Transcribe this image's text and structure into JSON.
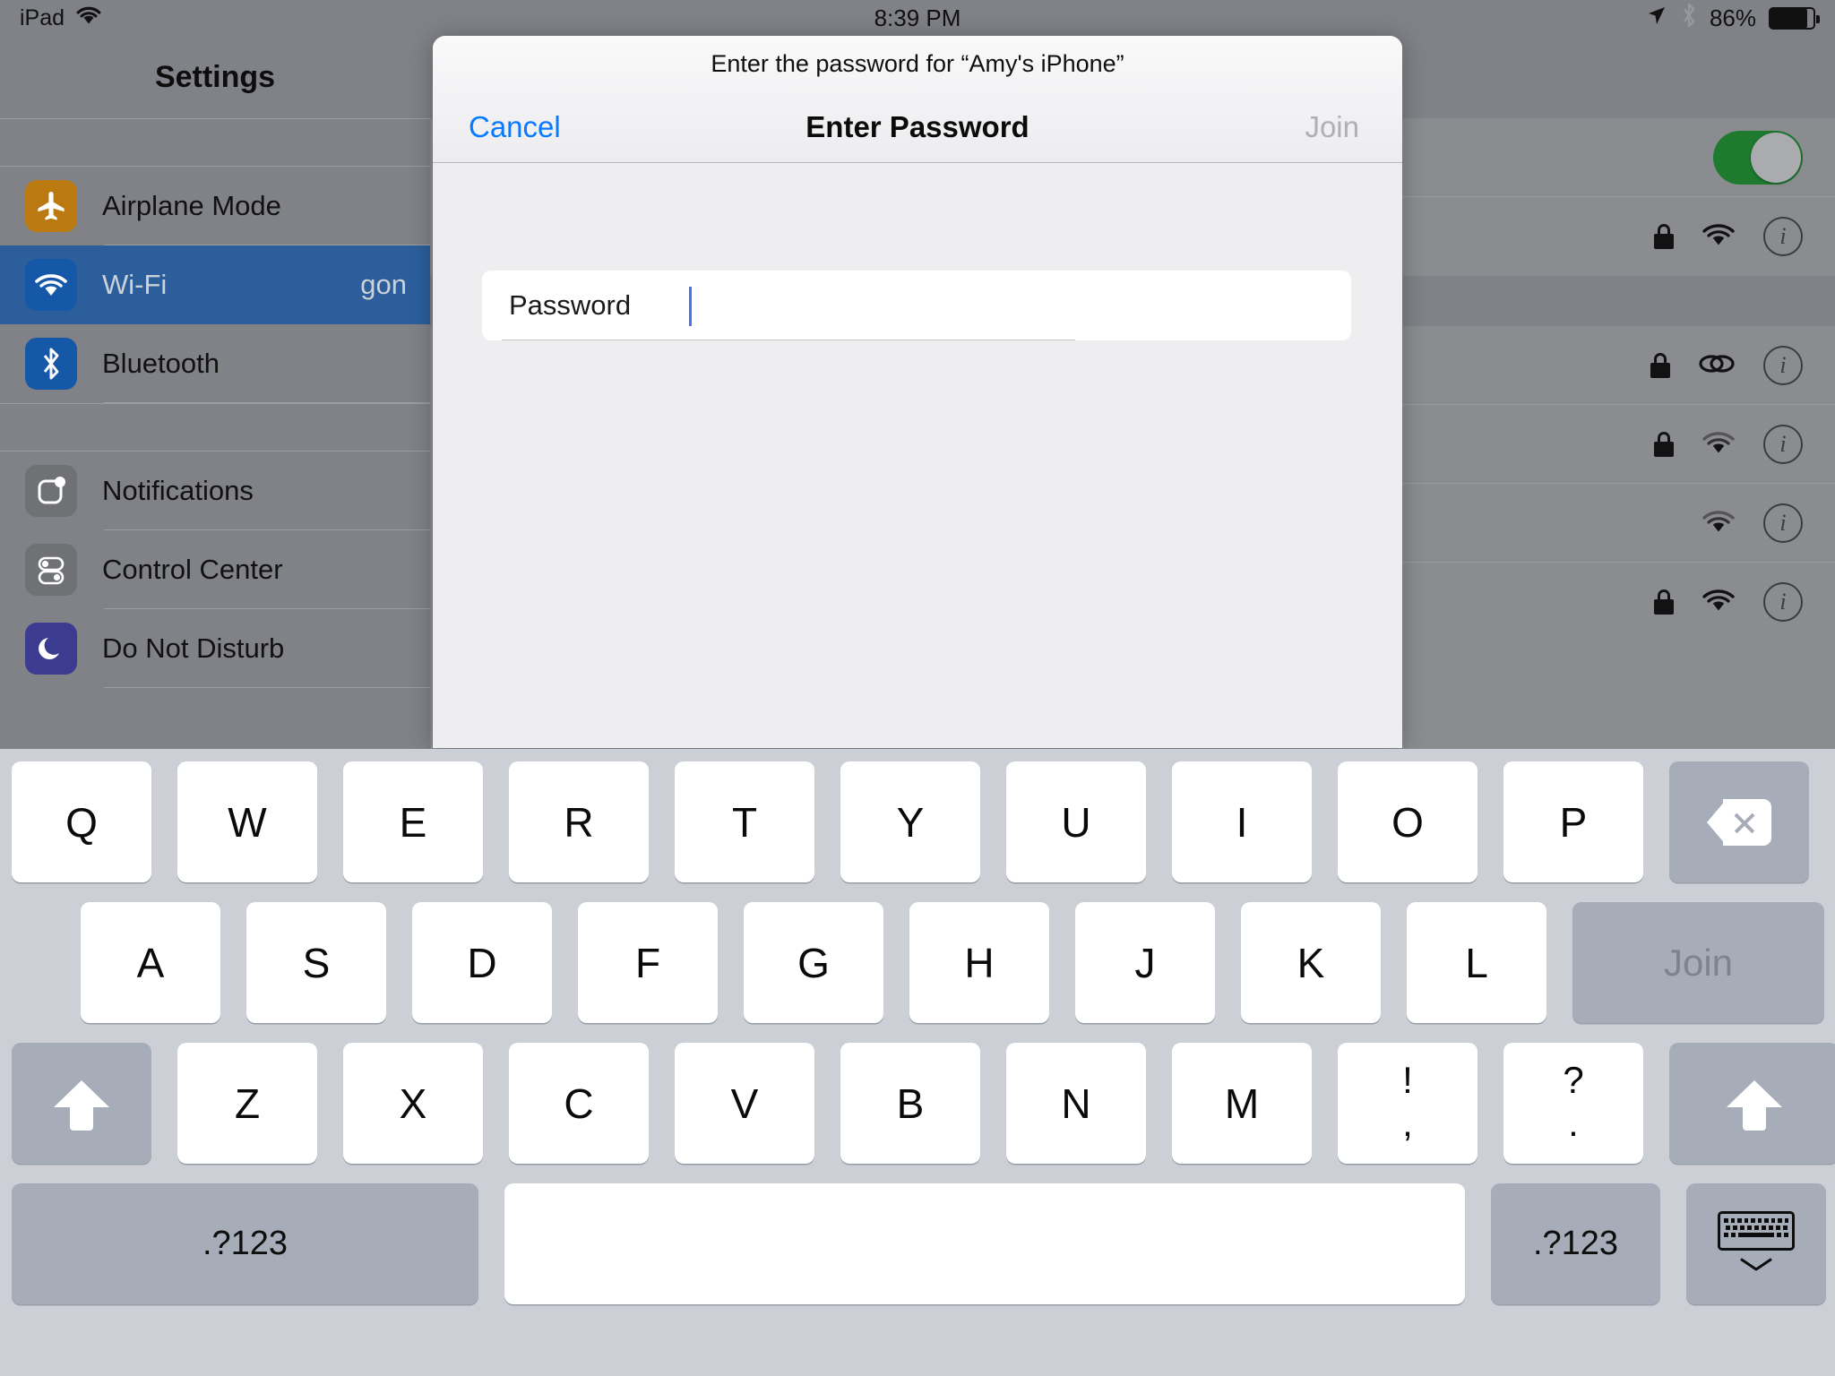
{
  "status_bar": {
    "device_label": "iPad",
    "wifi_icon": "wifi-icon",
    "time": "8:39 PM",
    "location_icon": "location-arrow-icon",
    "bluetooth_icon": "bluetooth-icon",
    "battery_percent": "86%",
    "battery_icon": "battery-icon"
  },
  "settings": {
    "title": "Settings",
    "sidebar_items": [
      {
        "label": "Airplane Mode",
        "icon": "airplane-icon",
        "selected": false,
        "value": ""
      },
      {
        "label": "Wi-Fi",
        "icon": "wifi-icon",
        "selected": true,
        "value": "gon"
      },
      {
        "label": "Bluetooth",
        "icon": "bluetooth-icon",
        "selected": false,
        "value": ""
      },
      {
        "label": "Notifications",
        "icon": "notifications-icon",
        "selected": false,
        "value": ""
      },
      {
        "label": "Control Center",
        "icon": "control-center-icon",
        "selected": false,
        "value": ""
      },
      {
        "label": "Do Not Disturb",
        "icon": "moon-icon",
        "selected": false,
        "value": ""
      }
    ],
    "network_rows": [
      {
        "accessories": [
          "toggle-on"
        ]
      },
      {
        "accessories": [
          "lock-icon",
          "wifi-icon",
          "info-icon"
        ]
      },
      {
        "accessories": [
          "lock-icon",
          "hotspot-link-icon",
          "info-icon"
        ]
      },
      {
        "accessories": [
          "lock-icon",
          "wifi-icon",
          "info-icon"
        ]
      },
      {
        "accessories": [
          "wifi-icon",
          "info-icon"
        ]
      },
      {
        "accessories": [
          "lock-icon",
          "wifi-icon",
          "info-icon"
        ]
      }
    ],
    "toggle_on_color": "#1e7a2e"
  },
  "dialog": {
    "subtitle": "Enter the password for “Amy's iPhone”",
    "cancel_label": "Cancel",
    "title": "Enter Password",
    "join_label": "Join",
    "join_enabled": false,
    "password_label": "Password",
    "password_value": "",
    "caret_color": "#4a72e8",
    "cancel_color": "#087aff"
  },
  "keyboard": {
    "row1": [
      "Q",
      "W",
      "E",
      "R",
      "T",
      "Y",
      "U",
      "I",
      "O",
      "P"
    ],
    "backspace_icon": "backspace-icon",
    "row2": [
      "A",
      "S",
      "D",
      "F",
      "G",
      "H",
      "J",
      "K",
      "L"
    ],
    "return_label": "Join",
    "shift_icon": "shift-icon",
    "row3": [
      "Z",
      "X",
      "C",
      "V",
      "B",
      "N",
      "M"
    ],
    "punct1_top": "!",
    "punct1_bottom": ",",
    "punct2_top": "?",
    "punct2_bottom": ".",
    "numbers_left_label": ".?123",
    "numbers_right_label": ".?123",
    "space_label": "",
    "dismiss_icon": "dismiss-keyboard-icon"
  }
}
